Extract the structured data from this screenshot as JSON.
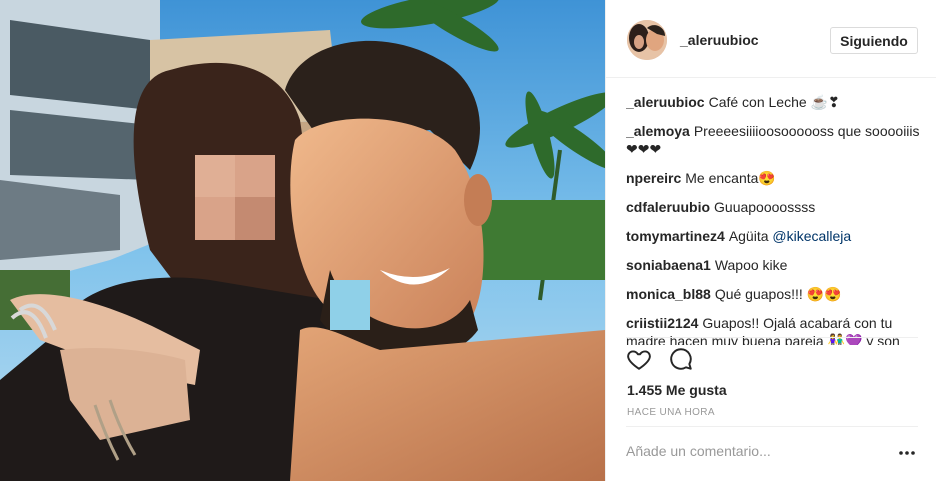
{
  "post": {
    "username": "_aleruubioc",
    "follow_label": "Siguiendo",
    "comments": [
      {
        "user": "_aleruubioc",
        "text": "Café con Leche ☕❣"
      },
      {
        "user": "_alemoya",
        "text": "Preeeesiiiioosoooooss que sooooiiis❤❤❤"
      },
      {
        "user": "npereirc",
        "text": "Me encanta😍"
      },
      {
        "user": "cdfaleruubio",
        "text": "Guuapoooossss"
      },
      {
        "user": "tomymartinez4",
        "text": "Agüita",
        "mention": "@kikecalleja"
      },
      {
        "user": "soniabaena1",
        "text": "Wapoo kike"
      },
      {
        "user": "monica_bl88",
        "text": "Qué guapos!!! 😍😍"
      },
      {
        "user": "criistii2124",
        "text": "Guapos!! Ojalá acabará con tu madre hacen muy buena pareja 👫💜 y son personas maravillosas"
      }
    ],
    "likes": "1.455 Me gusta",
    "time": "HACE UNA HORA",
    "comment_placeholder": "Añade un comentario...",
    "icons": {
      "like": "heart-icon",
      "comment": "comment-bubble-icon",
      "more": "more-options-icon"
    }
  }
}
